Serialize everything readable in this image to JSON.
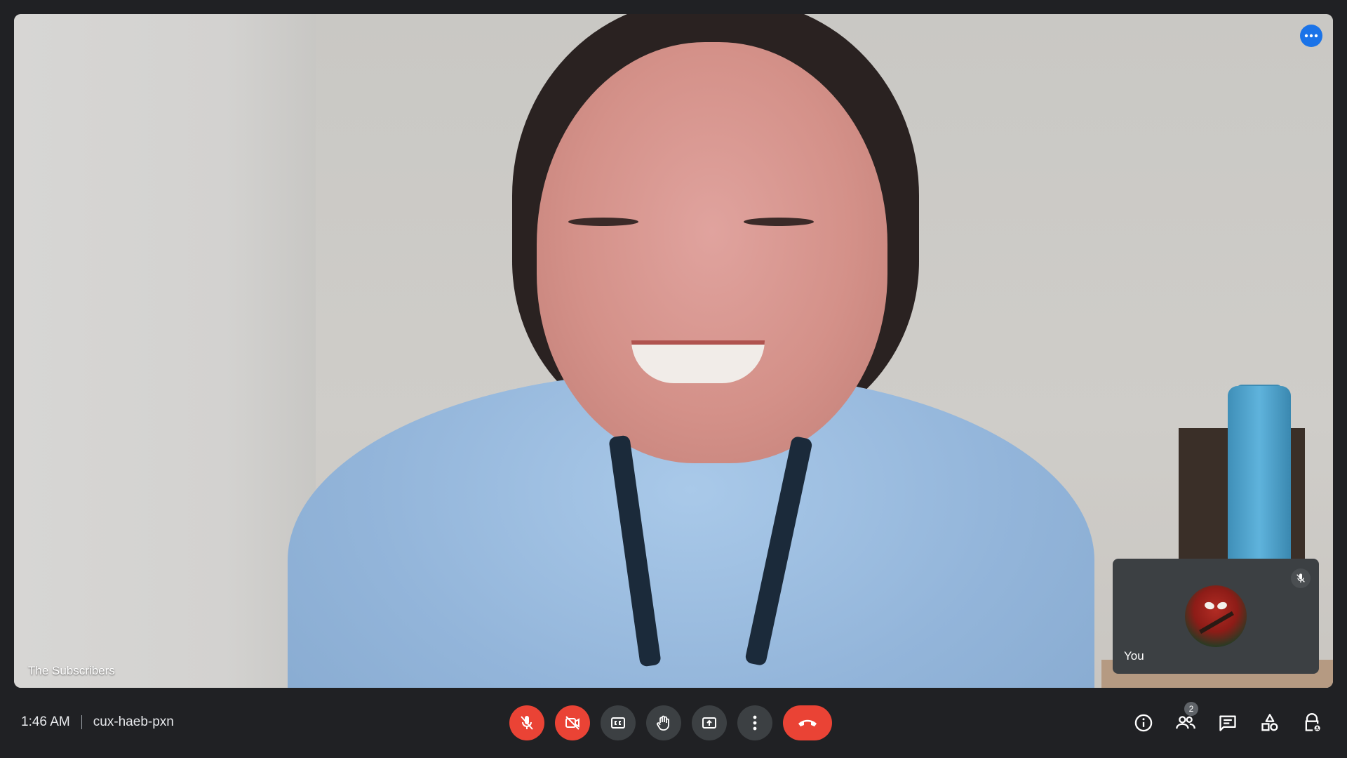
{
  "video": {
    "participant_name": "The Subscribers"
  },
  "self_view": {
    "label": "You"
  },
  "bottom_bar": {
    "time": "1:46 AM",
    "meeting_code": "cux-haeb-pxn"
  },
  "people": {
    "count": "2"
  },
  "icons": {
    "more_options": "more-horiz-icon",
    "mic_off": "mic-off-icon",
    "camera_off": "videocam-off-icon",
    "captions": "closed-caption-icon",
    "raise_hand": "hand-icon",
    "present": "present-screen-icon",
    "more_vert": "more-vert-icon",
    "end_call": "call-end-icon",
    "info": "info-icon",
    "people": "people-icon",
    "chat": "chat-icon",
    "activities": "activities-icon",
    "host_controls": "host-lock-icon"
  },
  "colors": {
    "background": "#202124",
    "control": "#3c4043",
    "danger": "#ea4335",
    "accent": "#1a73e8"
  }
}
